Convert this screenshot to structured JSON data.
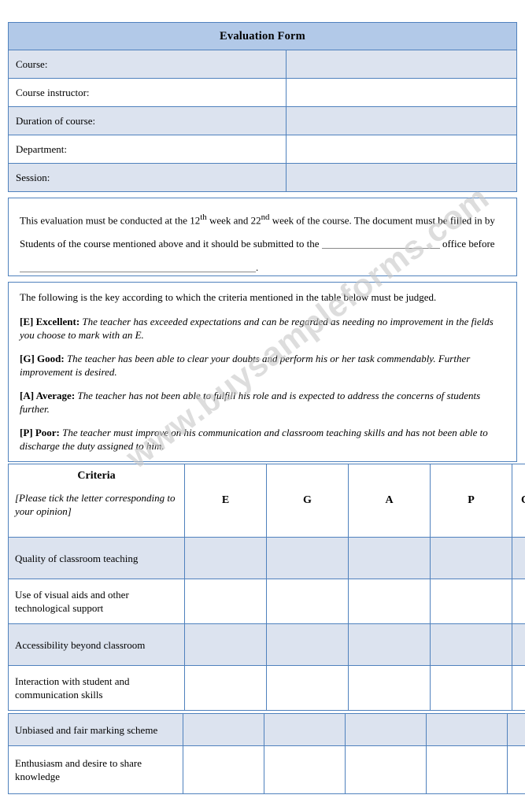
{
  "document": {
    "title": "Evaluation Form",
    "watermark": "www.buysampleforms.com"
  },
  "info_fields": [
    {
      "label": "Course:",
      "value": ""
    },
    {
      "label": "Course instructor:",
      "value": ""
    },
    {
      "label": "Duration of course:",
      "value": ""
    },
    {
      "label": "Department:",
      "value": ""
    },
    {
      "label": "Session:",
      "value": ""
    }
  ],
  "notice": {
    "line1_a": "This evaluation must be conducted at the 12",
    "line1_sup1": "th",
    "line1_b": " week and 22",
    "line1_sup2": "nd",
    "line1_c": " week of the course. The document must be filled in by",
    "line2_a": "Students of the course mentioned above and it should be submitted to the",
    "line2_b": "office before",
    "line3_tail": "."
  },
  "key": {
    "intro": "The following is the key according to which the criteria mentioned in the table below must be judged.",
    "items": [
      {
        "label": "[E] Excellent:",
        "description": "The teacher has exceeded expectations and can be regarded as needing no improvement in the fields you choose to mark with an E."
      },
      {
        "label": "[G] Good:",
        "description": "The teacher has been able to clear your doubts and perform his or her task commendably. Further improvement is desired."
      },
      {
        "label": "[A] Average:",
        "description": "The teacher has not been able to fulfill his role and is expected to address the concerns of students further."
      },
      {
        "label": "[P] Poor:",
        "description": "The teacher must improve on his communication and classroom teaching skills and has not been able to discharge the duty assigned to him."
      }
    ]
  },
  "criteria_table": {
    "header": {
      "criteria_title": "Criteria",
      "criteria_subtitle": "[Please tick the letter corresponding to your opinion]",
      "grade_e": "E",
      "grade_g": "G",
      "grade_a": "A",
      "grade_p": "P",
      "comments": "Comments"
    },
    "rows": [
      {
        "criterion": "Quality of classroom teaching",
        "e": "",
        "g": "",
        "a": "",
        "p": "",
        "comments": ""
      },
      {
        "criterion": "Use of visual aids and other technological support",
        "e": "",
        "g": "",
        "a": "",
        "p": "",
        "comments": ""
      },
      {
        "criterion": "Accessibility beyond classroom",
        "e": "",
        "g": "",
        "a": "",
        "p": "",
        "comments": ""
      },
      {
        "criterion": "Interaction with student and communication skills",
        "e": "",
        "g": "",
        "a": "",
        "p": "",
        "comments": ""
      }
    ]
  },
  "criteria_table_continued": {
    "rows": [
      {
        "criterion": "Unbiased and fair marking scheme",
        "e": "",
        "g": "",
        "a": "",
        "p": "",
        "comments": ""
      },
      {
        "criterion": "Enthusiasm and desire to share knowledge",
        "e": "",
        "g": "",
        "a": "",
        "p": "",
        "comments": ""
      }
    ]
  },
  "colors": {
    "border": "#4f81bd",
    "title_fill": "#b2c9e8",
    "row_fill": "#dce3ef",
    "watermark": "#c9c9c9"
  }
}
